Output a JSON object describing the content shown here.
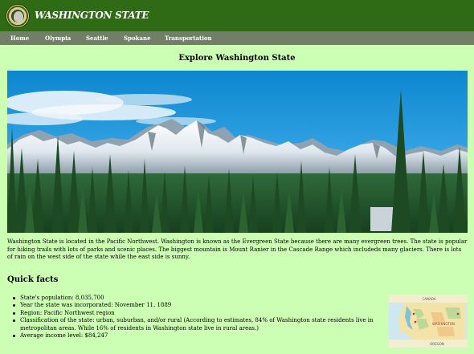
{
  "header": {
    "title": "WASHINGTON STATE",
    "logo_icon": "washington-state-seal-icon"
  },
  "nav": {
    "items": [
      {
        "label": "Home"
      },
      {
        "label": "Olympia"
      },
      {
        "label": "Seattle"
      },
      {
        "label": "Spokane"
      },
      {
        "label": "Transportation"
      }
    ]
  },
  "main": {
    "title": "Explore Washington State",
    "hero_image": "mountain-range-with-evergreen-forest-photo",
    "intro": "Washington State is located in the Pacific Northwest. Washington is known as the Evergreen State because there are many evergreen trees. The state is popular for hiking trails with lots of parks and scenic places. The biggest mountain is Mount Ranier in the Cascade Range which includeds many glaciers. There is lots of rain on the west side of the state while the east side is sunny.",
    "facts_heading": "Quick facts",
    "facts": [
      "State's population: 8,035,700",
      "Year the state was incorporated: November 11, 1889",
      "Region: Pacific Northwest region",
      "Classification of the state: urban, suburban, and/or rural (According to estimates, 84% of Washington state residents live in metropolitan areas. While 16% of residents in Washington state live in rural areas.)",
      "Average income level: $84,247"
    ],
    "map": {
      "image": "washington-state-map-icon",
      "labels": [
        "CANADA",
        "WASHINGTON",
        "OREGON"
      ]
    }
  },
  "colors": {
    "header_bg": "#2e6b14",
    "nav_bg": "#727e68",
    "page_bg": "#ccffb3"
  }
}
